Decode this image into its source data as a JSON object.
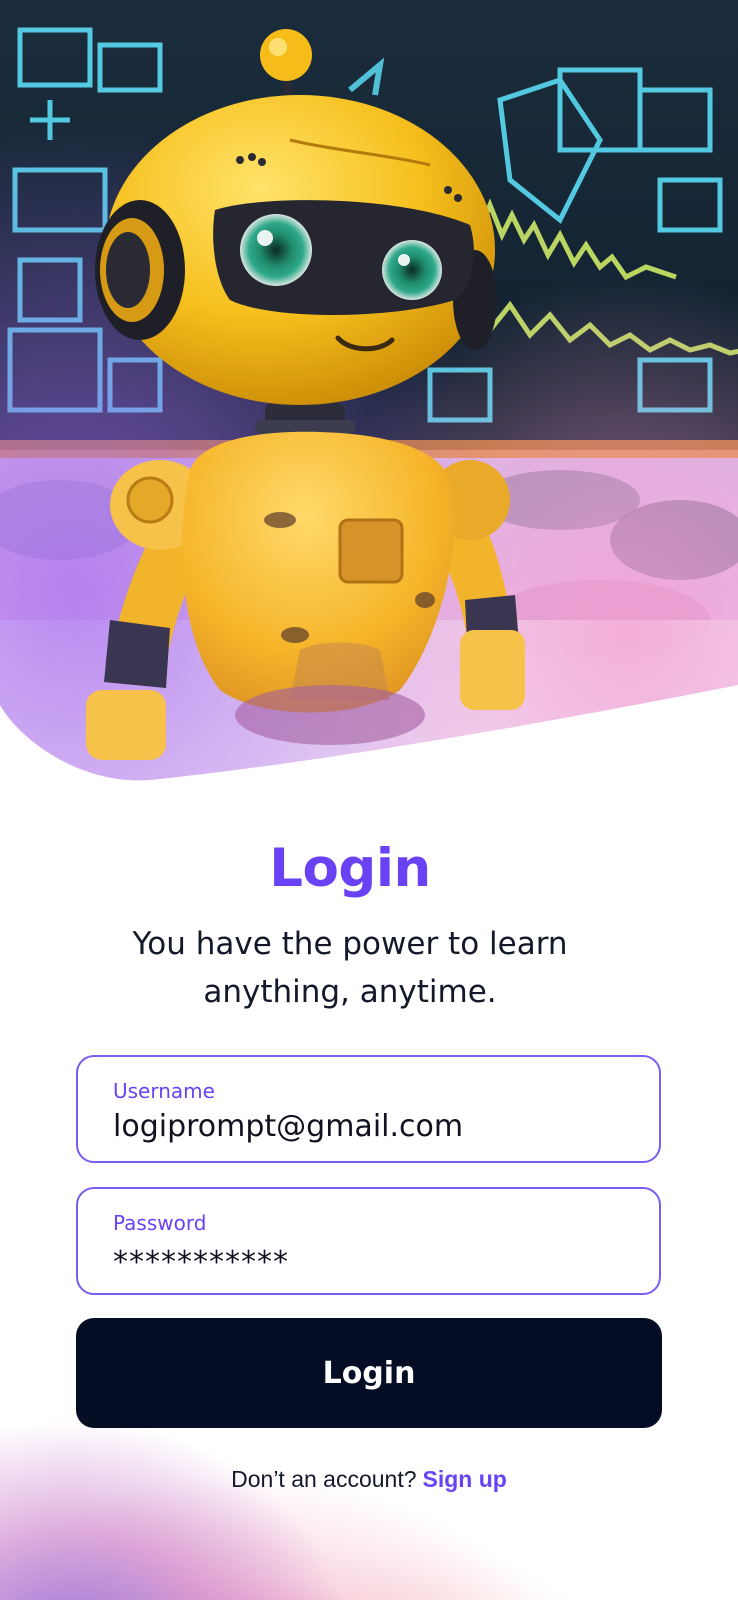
{
  "login": {
    "title": "Login",
    "subtitle_line1": "You have the power to learn",
    "subtitle_line2": "anything, anytime."
  },
  "username": {
    "label": "Username",
    "value": "logiprompt@gmail.com"
  },
  "password": {
    "label": "Password",
    "value": "***********"
  },
  "button": {
    "label": "Login"
  },
  "footer": {
    "prompt": "Don’t an account?",
    "link": "Sign up"
  },
  "colors": {
    "accent": "#6a42f5",
    "button_bg": "#050d24",
    "text": "#14182b"
  },
  "hero_image": "robot-mascot-in-classroom"
}
